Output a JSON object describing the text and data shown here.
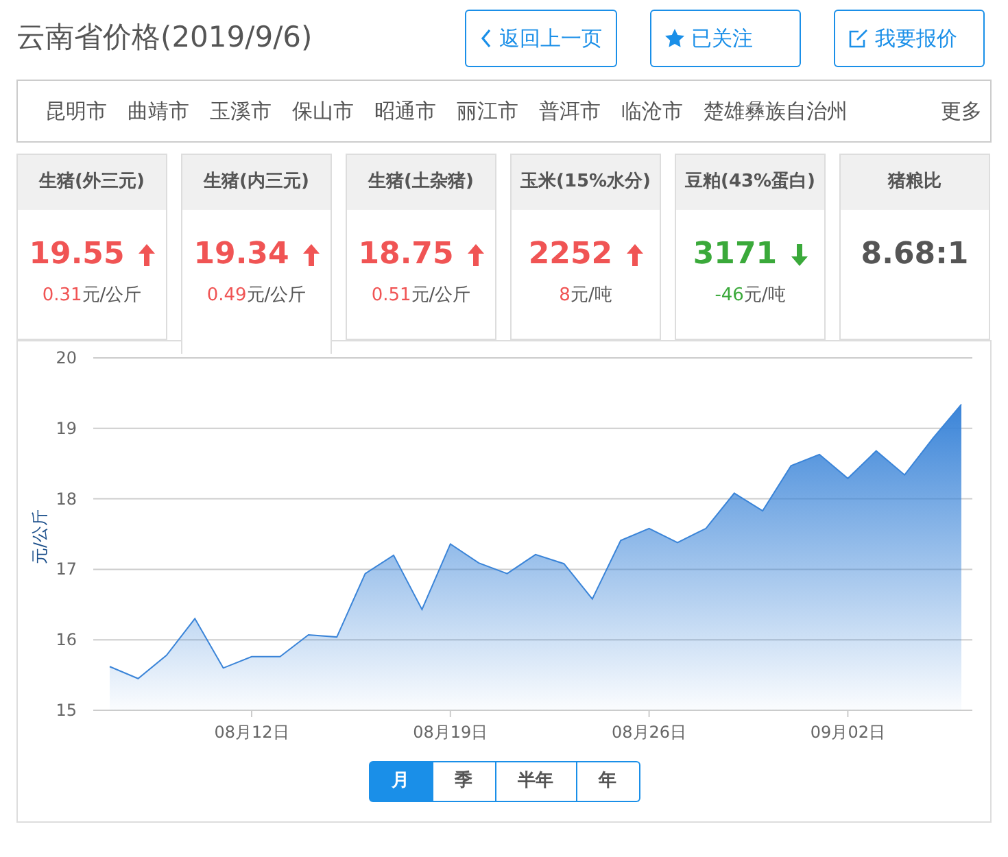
{
  "title": "云南省价格(2019/9/6)",
  "header_buttons": [
    {
      "kind": "back",
      "label": "返回上一页"
    },
    {
      "kind": "star",
      "label": "已关注"
    },
    {
      "kind": "edit",
      "label": "我要报价"
    }
  ],
  "cities": [
    "昆明市",
    "曲靖市",
    "玉溪市",
    "保山市",
    "昭通市",
    "丽江市",
    "普洱市",
    "临沧市",
    "楚雄彝族自治州"
  ],
  "more": "更多",
  "cards": [
    {
      "name": "生猪(外三元)",
      "price": "19.55",
      "kind": "up",
      "change": "0.31",
      "unit": "元/公斤",
      "selected": false
    },
    {
      "name": "生猪(内三元)",
      "price": "19.34",
      "kind": "up",
      "change": "0.49",
      "unit": "元/公斤",
      "selected": true
    },
    {
      "name": "生猪(土杂猪)",
      "price": "18.75",
      "kind": "up",
      "change": "0.51",
      "unit": "元/公斤",
      "selected": false
    },
    {
      "name": "玉米(15%水分)",
      "price": "2252",
      "kind": "up",
      "change": "8",
      "unit": "元/吨",
      "selected": false
    },
    {
      "name": "豆粕(43%蛋白)",
      "price": "3171",
      "kind": "down",
      "change": "-46",
      "unit": "元/吨",
      "selected": false
    },
    {
      "name": "猪粮比",
      "price": "8.68:1",
      "kind": "ratio",
      "selected": false
    }
  ],
  "chart": {
    "chart_data": {
      "type": "area",
      "ylabel": "元/公斤",
      "categories": [
        null,
        null,
        null,
        null,
        null,
        "08月12日",
        null,
        null,
        null,
        null,
        null,
        null,
        "08月19日",
        null,
        null,
        null,
        null,
        null,
        null,
        "08月26日",
        null,
        null,
        null,
        null,
        null,
        null,
        "09月02日",
        null,
        null,
        null,
        null
      ],
      "series": [
        {
          "color": "#3a84d8",
          "values": [
            15.62,
            15.45,
            15.78,
            16.3,
            15.6,
            15.76,
            15.76,
            16.07,
            16.04,
            16.94,
            17.2,
            16.43,
            17.36,
            17.09,
            16.94,
            17.21,
            17.08,
            16.58,
            17.41,
            17.58,
            17.38,
            17.58,
            18.08,
            17.83,
            18.47,
            18.63,
            18.29,
            18.68,
            18.34,
            18.86,
            19.34
          ]
        }
      ],
      "ylim": [
        15,
        20
      ],
      "grid": true,
      "yticks": [
        15,
        16,
        17,
        18,
        19,
        20
      ]
    },
    "ranges": [
      {
        "label": "月",
        "selected": true
      },
      {
        "label": "季",
        "selected": false
      },
      {
        "label": "半年",
        "selected": false
      },
      {
        "label": "年",
        "selected": false
      }
    ]
  }
}
